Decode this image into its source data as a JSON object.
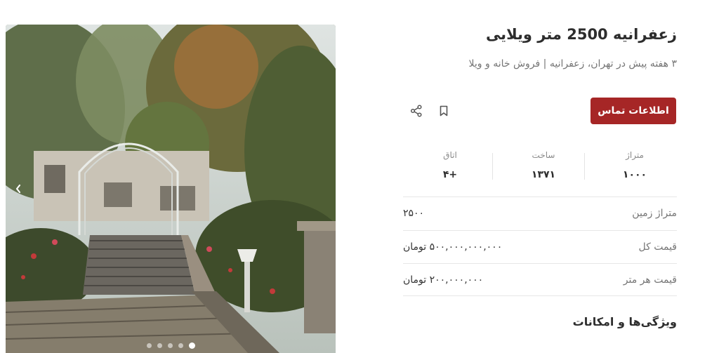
{
  "listing": {
    "title": "زعفرانیه 2500 متر ویلایی",
    "subtitle": "۳ هفته پیش در تهران، زعفرانیه | فروش خانه و ویلا",
    "contact_label": "اطلاعات تماس"
  },
  "stats": [
    {
      "label": "متراژ",
      "value": "۱۰۰۰"
    },
    {
      "label": "ساخت",
      "value": "۱۳۷۱"
    },
    {
      "label": "اتاق",
      "value": "+۴"
    }
  ],
  "details": [
    {
      "label": "متراژ زمین",
      "value": "۲۵۰۰"
    },
    {
      "label": "قیمت کل",
      "value": "۵۰۰,۰۰۰,۰۰۰,۰۰۰ تومان"
    },
    {
      "label": "قیمت هر متر",
      "value": "۲۰۰,۰۰۰,۰۰۰ تومان"
    }
  ],
  "features_title": "ویژگی‌ها و امکانات",
  "gallery": {
    "photo": "garden-stairs-photo",
    "image_count": 5,
    "active_index": 4
  },
  "icons": {
    "bookmark": "bookmark-icon",
    "share": "share-icon",
    "prev": "chevron-left-icon"
  },
  "colors": {
    "primary": "#a62626",
    "border": "#e6e6e6",
    "muted_text": "#757575"
  }
}
